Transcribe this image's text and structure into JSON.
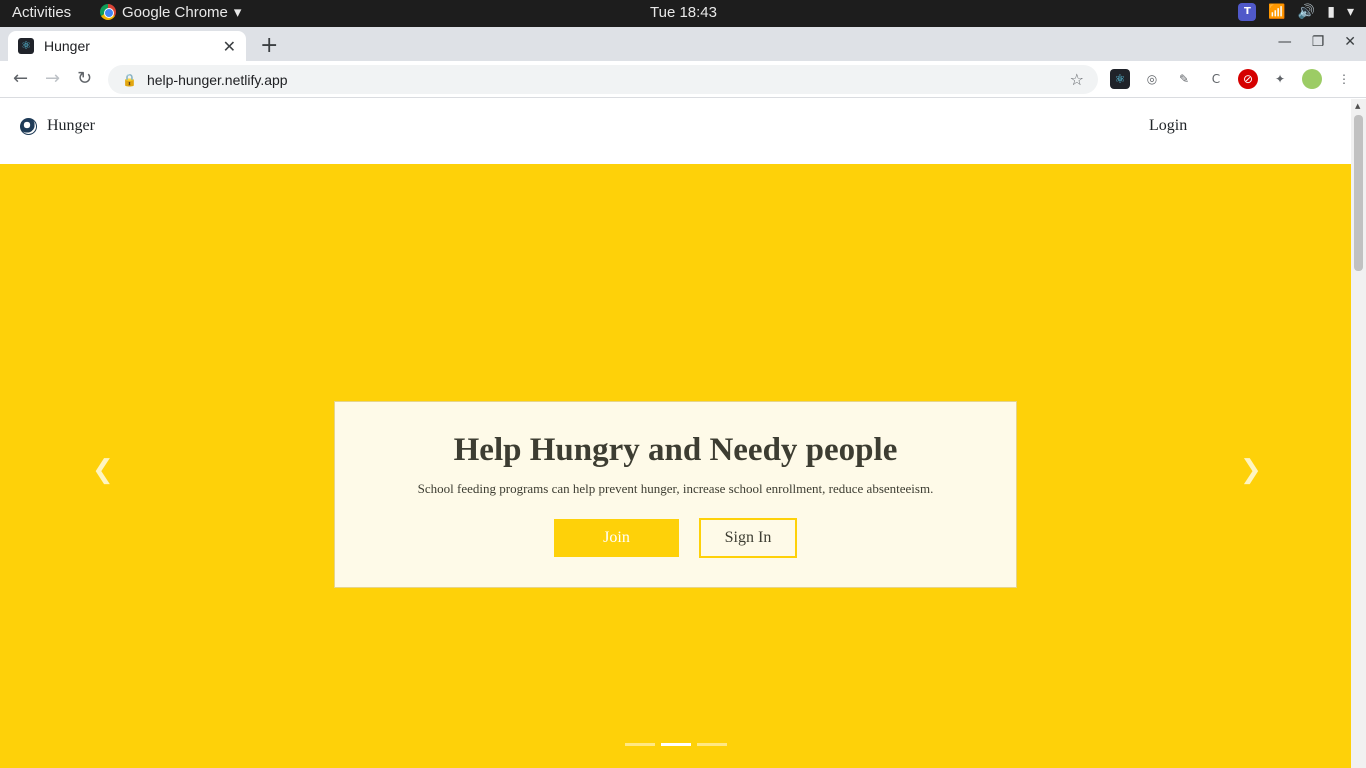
{
  "system_bar": {
    "activities": "Activities",
    "app_name": "Google Chrome",
    "clock": "Tue 18:43"
  },
  "browser": {
    "tab_title": "Hunger",
    "url": "help-hunger.netlify.app"
  },
  "site": {
    "brand": "Hunger",
    "login": "Login",
    "hero": {
      "heading": "Help Hungry and Needy people",
      "subtext": "School feeding programs can help prevent hunger, increase school enrollment, reduce absenteeism.",
      "join_label": "Join",
      "signin_label": "Sign In"
    },
    "carousel": {
      "slide_count": 3,
      "active_index": 1
    }
  },
  "colors": {
    "hero_background": "#fed109",
    "card_background": "#fefae8",
    "text_dark": "#3d3d32"
  },
  "icons": {
    "prev": "chevron-left-icon",
    "next": "chevron-right-icon",
    "lock": "lock-icon",
    "star": "star-icon"
  }
}
